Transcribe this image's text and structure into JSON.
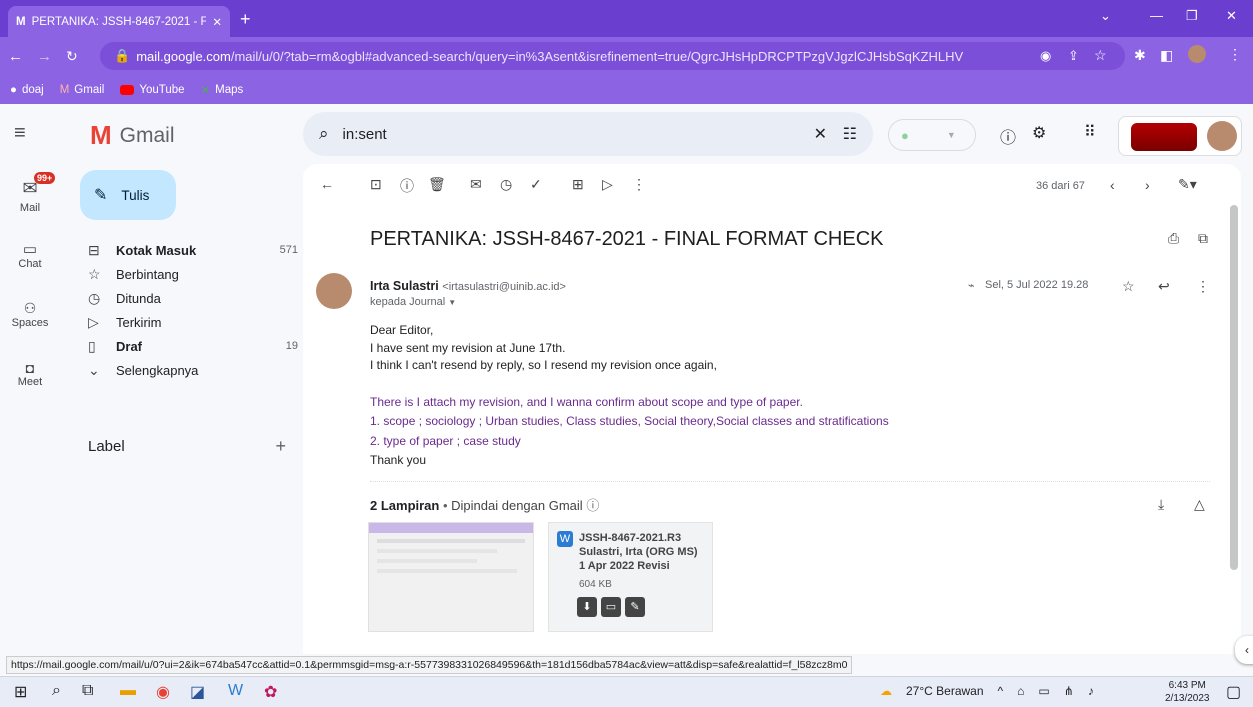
{
  "browser": {
    "tab_title": "PERTANIKA: JSSH-8467-2021 - Fi",
    "url_host": "mail.google.com",
    "url_path": "/mail/u/0/?tab=rm&ogbl#advanced-search/query=in%3Asent&isrefinement=true/QgrcJHsHpDRCPTPzgVJgzlCJHsbSqKZHLHV",
    "bookmarks": [
      "doaj",
      "Gmail",
      "YouTube",
      "Maps"
    ]
  },
  "gmail": {
    "logo_text": "Gmail",
    "search_value": "in:sent",
    "mail_badge": "99+",
    "rail": [
      "Mail",
      "Chat",
      "Spaces",
      "Meet"
    ],
    "compose": "Tulis",
    "nav": [
      {
        "label": "Kotak Masuk",
        "count": "571",
        "bold": true
      },
      {
        "label": "Berbintang",
        "count": ""
      },
      {
        "label": "Ditunda",
        "count": ""
      },
      {
        "label": "Terkirim",
        "count": ""
      },
      {
        "label": "Draf",
        "count": "19",
        "bold": true
      },
      {
        "label": "Selengkapnya",
        "count": ""
      }
    ],
    "label_heading": "Label",
    "pager": "36 dari 67"
  },
  "email": {
    "subject": "PERTANIKA: JSSH-8467-2021 - FINAL FORMAT CHECK",
    "sender_name": "Irta Sulastri",
    "sender_email": "<irtasulastri@uinib.ac.id>",
    "to": "kepada Journal",
    "date": "Sel, 5 Jul 2022 19.28",
    "body": [
      "Dear Editor,",
      "I have sent my revision at June 17th.",
      "I think I can't resend by reply, so I resend my revision once again,",
      "There is I attach my revision, and I wanna confirm about scope and type of paper.",
      "1. scope ; sociology ; Urban studies, Class studies, Social theory,Social classes and stratifications",
      "2. type of paper ; case study",
      "Thank you"
    ],
    "attachments_label": "2 Lampiran",
    "scan_label": "Dipindai dengan Gmail",
    "file": {
      "name_line1": "JSSH-8467-2021.R3",
      "name_line2": "Sulastri, Irta (ORG MS)",
      "name_line3": "1 Apr 2022 Revisi",
      "size": "604 KB"
    }
  },
  "status_url": "https://mail.google.com/mail/u/0?ui=2&ik=674ba547cc&attid=0.1&permmsgid=msg-a:r-5577398331026849596&th=181d156dba5784ac&view=att&disp=safe&realattid=f_l58zcz8m0",
  "taskbar": {
    "weather": "27°C Berawan",
    "time": "6:43 PM",
    "date": "2/13/2023"
  },
  "colors": {
    "chrome": "#6a3fcf",
    "tab": "#8b63e3",
    "compose": "#c2e7ff",
    "gmail_red": "#ea4335"
  }
}
